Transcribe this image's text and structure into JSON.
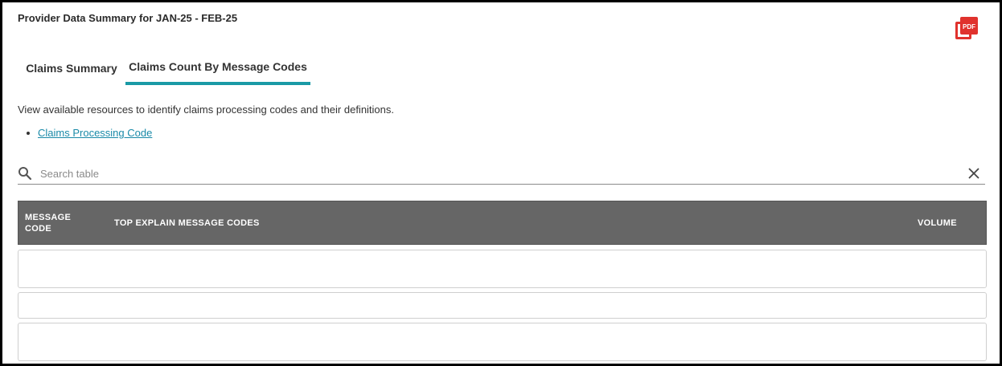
{
  "page": {
    "title": "Provider Data Summary for JAN-25 - FEB-25",
    "export_icon": "pdf-icon",
    "export_icon_label": "PDF",
    "colors": {
      "accent": "#1a9aa6",
      "link": "#1a8aa8",
      "table_header": "#666666",
      "pdf": "#e0322d"
    }
  },
  "tabs": [
    {
      "label": "Claims Summary",
      "active": false
    },
    {
      "label": "Claims Count By Message Codes",
      "active": true
    }
  ],
  "content": {
    "description": "View available resources to identify claims processing codes and their definitions.",
    "links": [
      {
        "label": "Claims Processing Code"
      }
    ]
  },
  "search": {
    "placeholder": "Search table",
    "value": "",
    "icon": "search-icon",
    "clear_icon": "close-icon"
  },
  "table": {
    "columns": [
      "MESSAGE CODE",
      "TOP EXPLAIN MESSAGE CODES",
      "VOLUME"
    ],
    "rows": [
      [],
      [],
      []
    ]
  }
}
